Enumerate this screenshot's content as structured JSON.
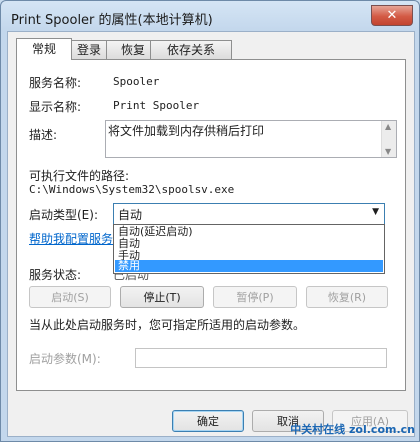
{
  "window": {
    "title": "Print Spooler 的属性(本地计算机)",
    "close_glyph": "✕"
  },
  "tabs": [
    {
      "label": "常规",
      "active": true
    },
    {
      "label": "登录"
    },
    {
      "label": "恢复"
    },
    {
      "label": "依存关系"
    }
  ],
  "general": {
    "service_name_label": "服务名称:",
    "service_name_value": "Spooler",
    "display_name_label": "显示名称:",
    "display_name_value": "Print Spooler",
    "description_label": "描述:",
    "description_value": "将文件加载到内存供稍后打印",
    "exe_path_label": "可执行文件的路径:",
    "exe_path_value": "C:\\Windows\\System32\\spoolsv.exe",
    "startup_type_label": "启动类型(E):",
    "startup_type_value": "自动",
    "startup_options": [
      "自动(延迟启动)",
      "自动",
      "手动",
      "禁用"
    ],
    "startup_selected_option": "禁用",
    "help_link": "帮助我配置服务启",
    "service_status_label": "服务状态:",
    "service_status_value": "已启动",
    "buttons": {
      "start": "启动(S)",
      "stop": "停止(T)",
      "pause": "暂停(P)",
      "resume": "恢复(R)"
    },
    "hint_text": "当从此处启动服务时，您可指定所适用的启动参数。",
    "start_params_label": "启动参数(M):",
    "start_params_value": ""
  },
  "footer": {
    "ok": "确定",
    "cancel": "取消",
    "apply": "应用(A)"
  },
  "watermark": "中关村在线 zol.com.cn",
  "colors": {
    "selection": "#3399ff",
    "link": "#0066cc",
    "close_button": "#d35a45"
  }
}
